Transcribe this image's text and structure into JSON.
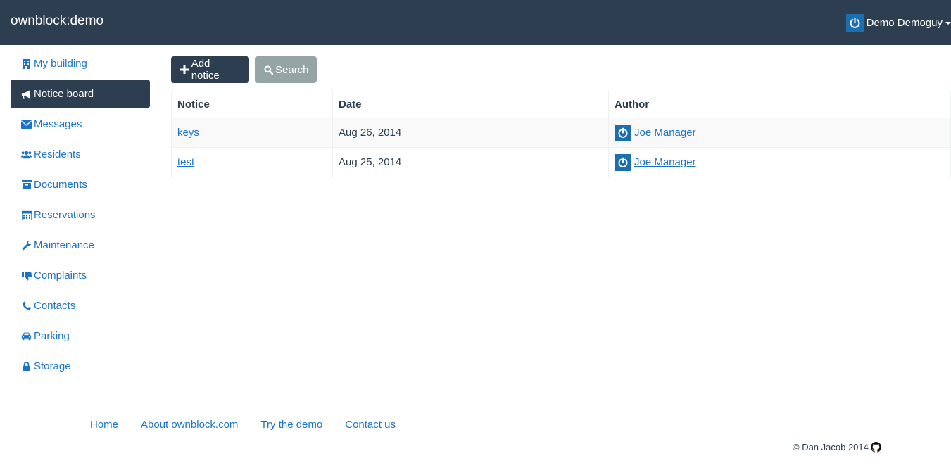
{
  "navbar": {
    "brand": "ownblock:demo",
    "user_name": "Demo Demoguy"
  },
  "sidebar": {
    "items": [
      {
        "label": "My building",
        "icon": "building-icon"
      },
      {
        "label": "Notice board",
        "icon": "bullhorn-icon",
        "active": true
      },
      {
        "label": "Messages",
        "icon": "envelope-icon"
      },
      {
        "label": "Residents",
        "icon": "users-icon"
      },
      {
        "label": "Documents",
        "icon": "archive-icon"
      },
      {
        "label": "Reservations",
        "icon": "calendar-icon"
      },
      {
        "label": "Maintenance",
        "icon": "wrench-icon"
      },
      {
        "label": "Complaints",
        "icon": "thumbs-down-icon"
      },
      {
        "label": "Contacts",
        "icon": "phone-icon"
      },
      {
        "label": "Parking",
        "icon": "car-icon"
      },
      {
        "label": "Storage",
        "icon": "lock-icon"
      }
    ]
  },
  "toolbar": {
    "add_label": "Add notice",
    "search_label": "Search"
  },
  "table": {
    "headers": [
      "Notice",
      "Date",
      "Author"
    ],
    "rows": [
      {
        "notice": "keys",
        "date": "Aug 26, 2014",
        "author": "Joe Manager"
      },
      {
        "notice": "test",
        "date": "Aug 25, 2014",
        "author": "Joe Manager"
      }
    ]
  },
  "footer": {
    "links": [
      "Home",
      "About ownblock.com",
      "Try the demo",
      "Contact us"
    ],
    "copyright": "© Dan Jacob 2014"
  },
  "colors": {
    "navbar": "#2c3e50",
    "link": "#1a73c7",
    "avatar": "#1b6fb0",
    "search_button": "#95a5a6"
  }
}
